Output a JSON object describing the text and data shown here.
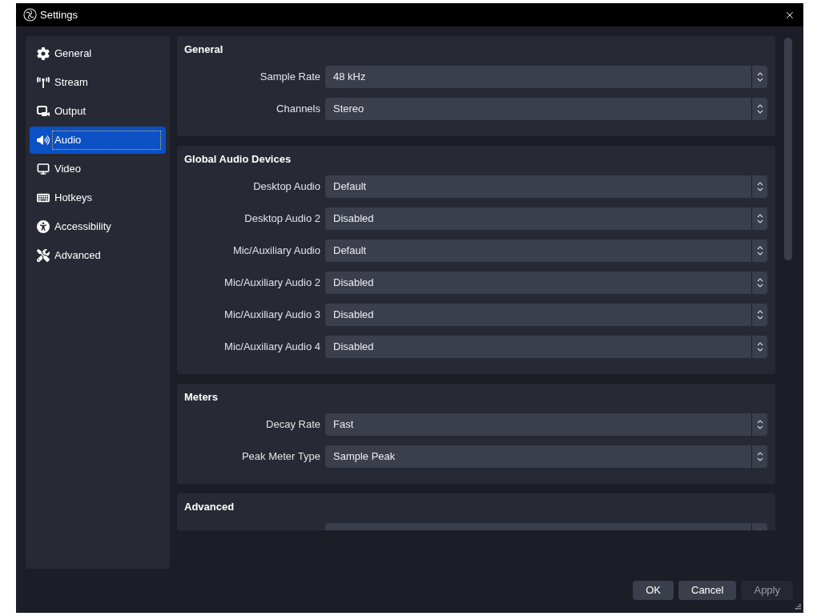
{
  "window": {
    "title": "Settings"
  },
  "sidebar": {
    "items": [
      {
        "label": "General",
        "selected": false
      },
      {
        "label": "Stream",
        "selected": false
      },
      {
        "label": "Output",
        "selected": false
      },
      {
        "label": "Audio",
        "selected": true
      },
      {
        "label": "Video",
        "selected": false
      },
      {
        "label": "Hotkeys",
        "selected": false
      },
      {
        "label": "Accessibility",
        "selected": false
      },
      {
        "label": "Advanced",
        "selected": false
      }
    ]
  },
  "sections": [
    {
      "title": "General",
      "rows": [
        {
          "kind": "select",
          "label": "Sample Rate",
          "value": "48 kHz"
        },
        {
          "kind": "select",
          "label": "Channels",
          "value": "Stereo"
        }
      ]
    },
    {
      "title": "Global Audio Devices",
      "rows": [
        {
          "kind": "select",
          "label": "Desktop Audio",
          "value": "Default"
        },
        {
          "kind": "select",
          "label": "Desktop Audio 2",
          "value": "Disabled"
        },
        {
          "kind": "select",
          "label": "Mic/Auxiliary Audio",
          "value": "Default"
        },
        {
          "kind": "select",
          "label": "Mic/Auxiliary Audio 2",
          "value": "Disabled"
        },
        {
          "kind": "select",
          "label": "Mic/Auxiliary Audio 3",
          "value": "Disabled"
        },
        {
          "kind": "select",
          "label": "Mic/Auxiliary Audio 4",
          "value": "Disabled"
        }
      ]
    },
    {
      "title": "Meters",
      "rows": [
        {
          "kind": "select",
          "label": "Decay Rate",
          "value": "Fast"
        },
        {
          "kind": "select",
          "label": "Peak Meter Type",
          "value": "Sample Peak"
        }
      ]
    },
    {
      "title": "Advanced",
      "rows": [
        {
          "kind": "select"
        }
      ]
    }
  ],
  "buttons": [
    {
      "label": "OK",
      "disabled": false
    },
    {
      "label": "Cancel",
      "disabled": false
    },
    {
      "label": "Apply",
      "disabled": true
    }
  ]
}
